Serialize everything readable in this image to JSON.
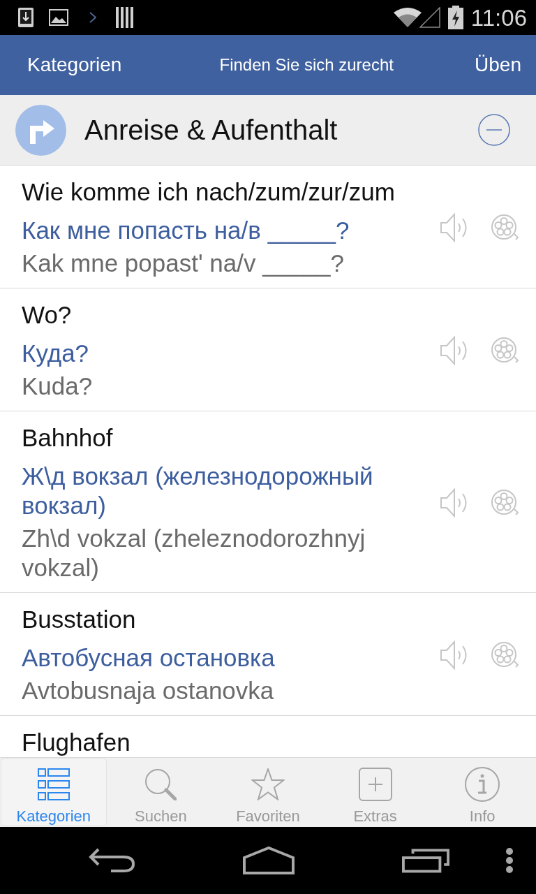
{
  "status_bar": {
    "time": "11:06"
  },
  "nav_bar": {
    "left_button": "Kategorien",
    "title": "Finden Sie sich zurecht",
    "right_button": "Üben"
  },
  "section": {
    "title": "Anreise & Aufenthalt",
    "expanded": true
  },
  "phrases": [
    {
      "german": "Wie komme ich nach/zum/zur/zum",
      "russian": "Как мне попасть на/в _____?",
      "transliteration": "Kak mne popastʹ na/v _____?"
    },
    {
      "german": "Wo?",
      "russian": "Куда?",
      "transliteration": "Kuda?"
    },
    {
      "german": "Bahnhof",
      "russian": "Ж\\д вокзал (железнодорожный вокзал)",
      "transliteration": "Zh\\d vokzal (zheleznodorozhnyj vokzal)"
    },
    {
      "german": "Busstation",
      "russian": "Автобусная остановка",
      "transliteration": "Avtobusnaja ostanovka"
    },
    {
      "german": "Flughafen"
    }
  ],
  "tabs": [
    {
      "kind": "categories",
      "label": "Kategorien",
      "selected": true
    },
    {
      "kind": "search",
      "label": "Suchen",
      "selected": false
    },
    {
      "kind": "favorites",
      "label": "Favoriten",
      "selected": false
    },
    {
      "kind": "extras",
      "label": "Extras",
      "selected": false
    },
    {
      "kind": "info",
      "label": "Info",
      "selected": false
    }
  ]
}
